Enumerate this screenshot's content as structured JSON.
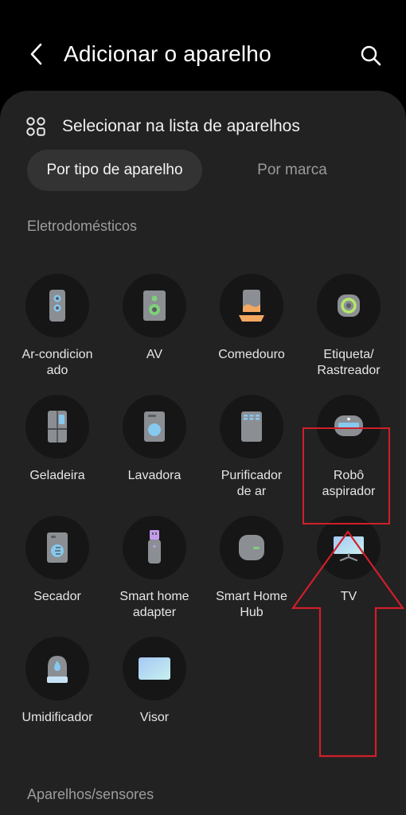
{
  "header": {
    "title": "Adicionar o aparelho",
    "back_icon": "chevron-left-icon",
    "search_icon": "search-icon"
  },
  "section": {
    "icon": "grid-icon",
    "label": "Selecionar na lista de aparelhos"
  },
  "tabs": [
    {
      "label": "Por tipo de aparelho",
      "active": true
    },
    {
      "label": "Por marca",
      "active": false
    }
  ],
  "categories": {
    "appliances": "Eletrodomésticos",
    "sensors": "Aparelhos/sensores"
  },
  "devices": [
    {
      "label": "Ar-condicion\nado",
      "icon": "air-conditioner-icon"
    },
    {
      "label": "AV",
      "icon": "speaker-icon"
    },
    {
      "label": "Comedouro",
      "icon": "pet-feeder-icon"
    },
    {
      "label": "Etiqueta/\nRastreador",
      "icon": "tag-tracker-icon"
    },
    {
      "label": "Geladeira",
      "icon": "refrigerator-icon"
    },
    {
      "label": "Lavadora",
      "icon": "washer-icon"
    },
    {
      "label": "Purificador\nde ar",
      "icon": "air-purifier-icon"
    },
    {
      "label": "Robô\naspirador",
      "icon": "robot-vacuum-icon"
    },
    {
      "label": "Secador",
      "icon": "dryer-icon"
    },
    {
      "label": "Smart home\nadapter",
      "icon": "usb-adapter-icon"
    },
    {
      "label": "Smart Home\nHub",
      "icon": "hub-icon"
    },
    {
      "label": "TV",
      "icon": "tv-icon"
    },
    {
      "label": "Umidificador",
      "icon": "humidifier-icon"
    },
    {
      "label": "Visor",
      "icon": "display-icon"
    }
  ],
  "annotation": {
    "highlight_color": "#d01f2a",
    "highlighted_item": "TV"
  }
}
